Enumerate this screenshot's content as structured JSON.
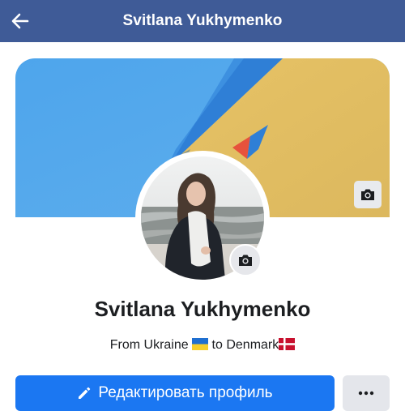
{
  "header": {
    "title": "Svitlana Yukhymenko",
    "back_icon": "arrow-left-icon",
    "background": "#3f5b97"
  },
  "cover": {
    "camera_icon": "camera-icon",
    "colors": {
      "blue": "#56aaed",
      "yellow": "#e3be63"
    }
  },
  "profile": {
    "name": "Svitlana Yukhymenko",
    "avatar_camera_icon": "camera-icon",
    "bio_prefix": "From Ukraine ",
    "bio_middle": " to Denmark",
    "flag_from": "ukraine-flag",
    "flag_to": "denmark-flag"
  },
  "actions": {
    "edit_label": "Редактировать профиль",
    "edit_icon": "pencil-icon",
    "more_icon": "more-dots-icon",
    "primary_color": "#1b77f2"
  }
}
